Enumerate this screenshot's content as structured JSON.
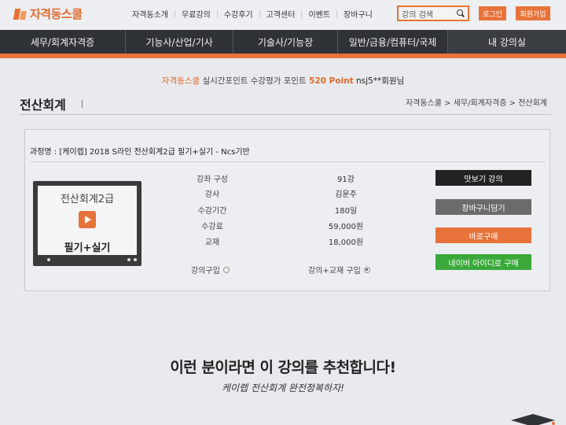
{
  "header": {
    "brand": "자격동스쿨",
    "top_links": [
      "자격동소개",
      "무료강의",
      "수강후기",
      "고객센터",
      "이벤트",
      "장바구니"
    ],
    "search_placeholder": "강의 검색",
    "login": "로그인",
    "signup": "회원가입"
  },
  "main_nav": [
    "세무/회계자격증",
    "기능사/산업/기사",
    "기술사/기능장",
    "일반/금융/컴퓨터/국제",
    "내 강의실"
  ],
  "points": {
    "brand": "자격동스쿨",
    "text": "실시간포인트 수강평가 포인트",
    "value": "520 Point",
    "user": "nsj5**회원님"
  },
  "page": {
    "title": "전산회계",
    "breadcrumb": "자격동스쿨 > 세무/회계자격증 > 전산회계"
  },
  "course": {
    "name": "과정명 : [케이렙] 2018 S라인 전산회계2급 필기+실기 - Ncs기반",
    "thumb_title": "전산회계2급",
    "thumb_subtitle": "필기+실기",
    "details": [
      {
        "label": "강좌 구성",
        "value": "91강"
      },
      {
        "label": "강사",
        "value": "김운주"
      },
      {
        "label": "수강기간",
        "value": "180일"
      },
      {
        "label": "수강료",
        "value": "59,000원"
      },
      {
        "label": "교재",
        "value": "18,000원"
      }
    ],
    "options": [
      {
        "label": "강의구입",
        "selected": false
      },
      {
        "label": "강의+교재 구입",
        "selected": true
      }
    ],
    "actions": [
      {
        "label": "맛보기 강의",
        "color": "#222222"
      },
      {
        "label": "장바구니담기",
        "color": "#6b6b6b"
      },
      {
        "label": "바로구매",
        "color": "#e8733a"
      },
      {
        "label": "네이버 아이디로 구매",
        "color": "#3aa93a"
      }
    ]
  },
  "promo": {
    "headline": "이런 분이라면 이 강의를 추천합니다!",
    "subline": "케이렙 전산회계 완전정복하자!"
  },
  "colors": {
    "accent": "#e8733a",
    "nav_bg": "#2f3237"
  }
}
